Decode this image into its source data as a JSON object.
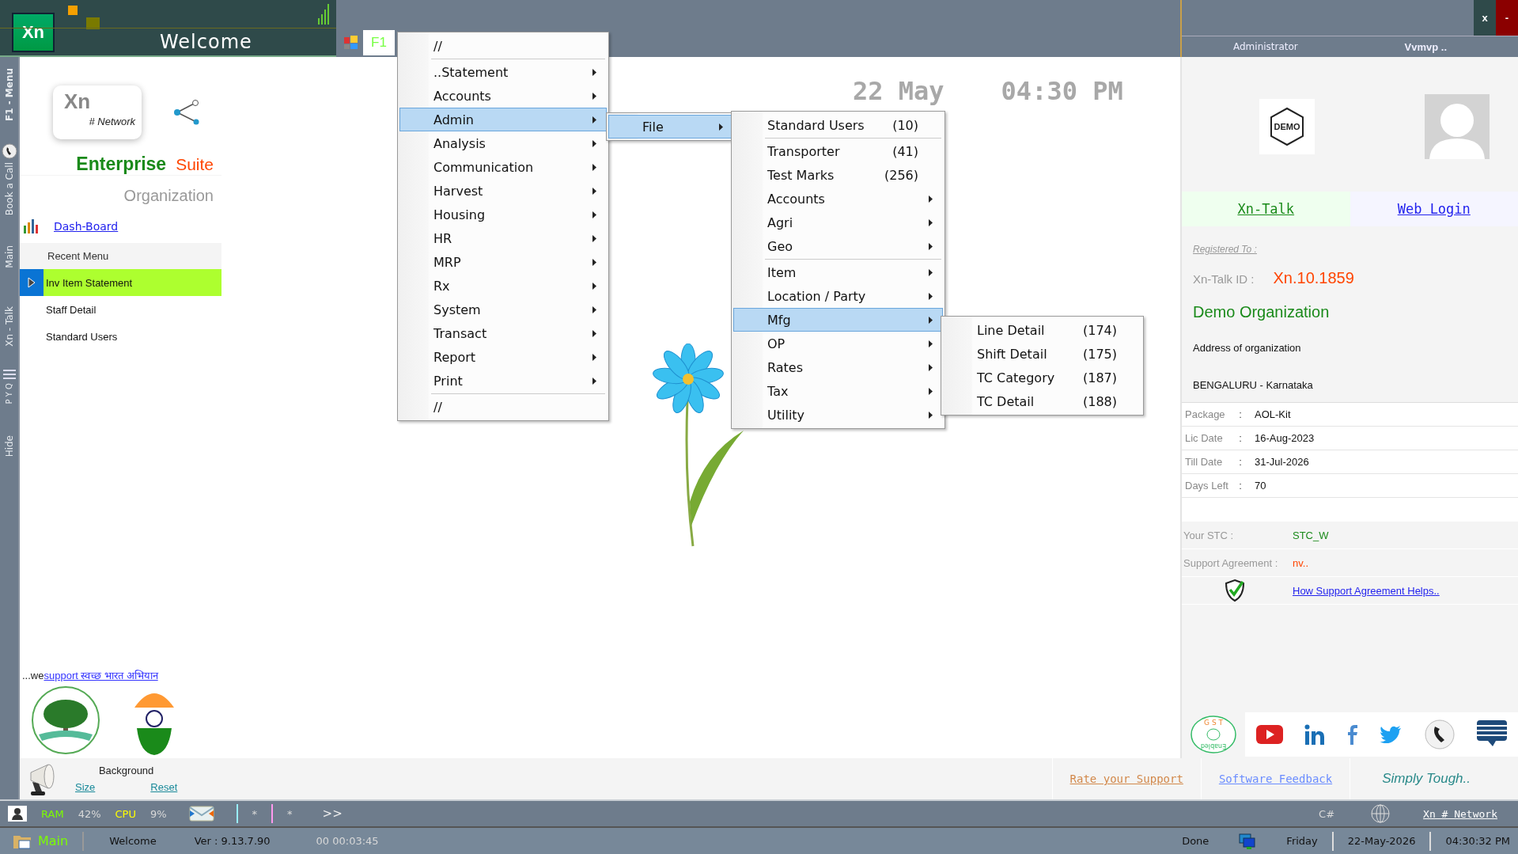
{
  "header": {
    "logo": "Xn",
    "title": "Welcome",
    "f1_tab": "F1"
  },
  "side_tabs": [
    "F1 - Menu",
    "Book a Call",
    "Main",
    "Xn - Talk",
    "P Y Q",
    "Hide"
  ],
  "brand": {
    "logo_text": "Xn",
    "logo_tag": "# Network",
    "edition": "Enterprise",
    "suite": "Suite",
    "organization": "Organization"
  },
  "dashboard_link": "Dash-Board",
  "recent_menu": {
    "title": "Recent Menu",
    "items": [
      {
        "label": "Inv Item Statement",
        "selected": true
      },
      {
        "label": "Staff Detail",
        "selected": false
      },
      {
        "label": "Standard Users",
        "selected": false
      }
    ]
  },
  "support_line": {
    "prefix": "...we",
    "link": "support स्वच्छ भारत अभियान"
  },
  "background": {
    "title": "Background",
    "size_link": "Size",
    "reset_link": "Reset"
  },
  "clock": {
    "date": "22 May",
    "time": "04:30 PM"
  },
  "menus": [
    {
      "groups": [
        [
          {
            "label": "//",
            "submenu": false,
            "selected": false
          }
        ],
        [
          {
            "label": "..Statement",
            "submenu": true,
            "selected": false
          },
          {
            "label": "Accounts",
            "submenu": true,
            "selected": false
          },
          {
            "label": "Admin",
            "submenu": true,
            "selected": true
          },
          {
            "label": "Analysis",
            "submenu": true,
            "selected": false
          },
          {
            "label": "Communication",
            "submenu": true,
            "selected": false
          },
          {
            "label": "Harvest",
            "submenu": true,
            "selected": false
          },
          {
            "label": "Housing",
            "submenu": true,
            "selected": false
          },
          {
            "label": "HR",
            "submenu": true,
            "selected": false
          },
          {
            "label": "MRP",
            "submenu": true,
            "selected": false
          },
          {
            "label": "Rx",
            "submenu": true,
            "selected": false
          },
          {
            "label": "System",
            "submenu": true,
            "selected": false
          },
          {
            "label": "Transact",
            "submenu": true,
            "selected": false
          },
          {
            "label": "Report",
            "submenu": true,
            "selected": false
          },
          {
            "label": "Print",
            "submenu": true,
            "selected": false
          }
        ],
        [
          {
            "label": "//",
            "submenu": false,
            "selected": false
          }
        ]
      ]
    },
    {
      "groups": [
        [
          {
            "label": "File",
            "submenu": true,
            "selected": true
          }
        ]
      ]
    },
    {
      "groups": [
        [
          {
            "label": "Standard Users",
            "count": "(10)",
            "submenu": false,
            "selected": false
          }
        ],
        [
          {
            "label": "Transporter",
            "count": "(41)",
            "submenu": false,
            "selected": false
          },
          {
            "label": "Test Marks",
            "count": "(256)",
            "submenu": false,
            "selected": false
          },
          {
            "label": "Accounts",
            "submenu": true,
            "selected": false
          },
          {
            "label": "Agri",
            "submenu": true,
            "selected": false
          },
          {
            "label": "Geo",
            "submenu": true,
            "selected": false
          }
        ],
        [
          {
            "label": "Item",
            "submenu": true,
            "selected": false
          },
          {
            "label": "Location / Party",
            "submenu": true,
            "selected": false
          },
          {
            "label": "Mfg",
            "submenu": true,
            "selected": true
          },
          {
            "label": "OP",
            "submenu": true,
            "selected": false
          },
          {
            "label": "Rates",
            "submenu": true,
            "selected": false
          },
          {
            "label": "Tax",
            "submenu": true,
            "selected": false
          },
          {
            "label": "Utility",
            "submenu": true,
            "selected": false
          }
        ]
      ]
    },
    {
      "groups": [
        [
          {
            "label": "Line Detail",
            "count": "(174)",
            "submenu": false,
            "selected": false
          },
          {
            "label": "Shift Detail",
            "count": "(175)",
            "submenu": false,
            "selected": false
          },
          {
            "label": "TC Category",
            "count": "(187)",
            "submenu": false,
            "selected": false
          },
          {
            "label": "TC Detail",
            "count": "(188)",
            "submenu": false,
            "selected": false
          }
        ]
      ]
    }
  ],
  "right_panel": {
    "close": "x",
    "minimize": "-",
    "user": "Administrator",
    "org_short": "Vvmvp ..",
    "demo_badge": "DEMO",
    "xn_talk_link": "Xn-Talk",
    "web_login_link": "Web Login",
    "registered_label": "Registered To :",
    "talk_id_label": "Xn-Talk ID :",
    "talk_id": "Xn.10.1859",
    "org_name": "Demo Organization",
    "address": "Address of organization",
    "city": "BENGALURU - Karnataka",
    "license": [
      {
        "label": "Package",
        "separator": ":",
        "value": "AOL-Kit"
      },
      {
        "label": "Lic Date",
        "separator": ":",
        "value": "16-Aug-2023"
      },
      {
        "label": "Till Date",
        "separator": ":",
        "value": "31-Jul-2026"
      },
      {
        "label": "Days Left",
        "separator": ":",
        "value": "70"
      }
    ],
    "stc_label": "Your STC :",
    "stc": "STC_W",
    "support_label": "Support Agreement :",
    "support_value": "nv..",
    "support_help_link": "How Support Agreement Helps..",
    "gst_badge": {
      "top": "G S T",
      "bottom": "Enabled"
    }
  },
  "footer_links": {
    "rate": "Rate your Support",
    "feedback": "Software Feedback",
    "tagline": "Simply Tough.."
  },
  "status_bar": {
    "ram_label": "RAM",
    "ram": "42%",
    "cpu_label": "CPU",
    "cpu": "9%",
    "mark_1": "*",
    "mark_2": "*",
    "more": ">>",
    "lang": "C#",
    "network_link": "Xn # Network"
  },
  "task_bar": {
    "main": "Main",
    "screen": "Welcome",
    "version": "Ver : 9.13.7.90",
    "uptime": "00 00:03:45",
    "status": "Done",
    "day": "Friday",
    "date": "22-May-2026",
    "time": "04:30:32 PM"
  }
}
